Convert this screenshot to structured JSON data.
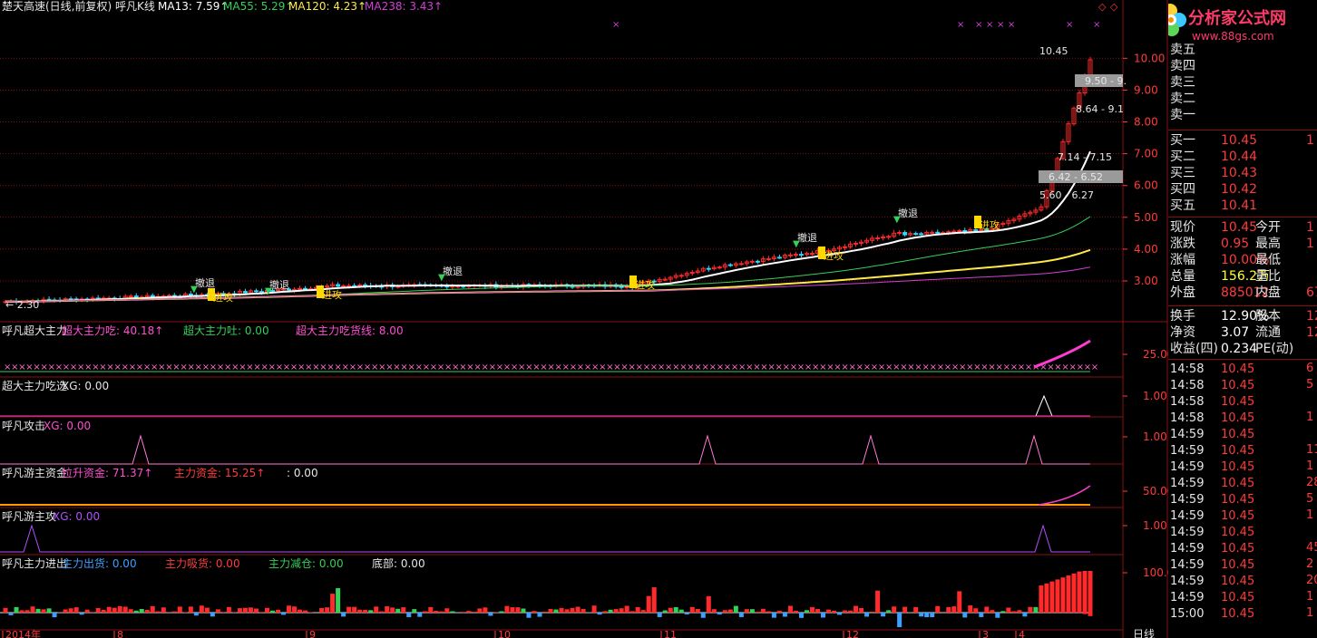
{
  "header": {
    "title": "楚天高速(日线,前复权) 呼凡K线",
    "ma": [
      {
        "label": "MA13: 7.59",
        "color": "#ffffff"
      },
      {
        "label": "MA55: 5.29",
        "color": "#34d058"
      },
      {
        "label": "MA120: 4.23",
        "color": "#ffe94a"
      },
      {
        "label": "MA238: 3.43",
        "color": "#d040d8"
      }
    ]
  },
  "price_axis": {
    "labels": [
      "10.00",
      "9.00",
      "8.00",
      "7.00",
      "6.00",
      "5.00",
      "4.00",
      "3.00"
    ]
  },
  "price_annotations": {
    "high": "10.45",
    "low": "2.30",
    "chips": [
      "9.50 - 9.",
      "8.64 - 9.1",
      "7.14 - 7.15",
      "6.42 - 6.52",
      "5.60 - 6.27"
    ]
  },
  "signals": {
    "retreat": "撤退",
    "attack": "进攻"
  },
  "panels": [
    {
      "name": "super-main",
      "items": [
        {
          "text": "呼凡超大主力",
          "color": "#e6e6e6"
        },
        {
          "text": "超大主力吃: 40.18",
          "color": "#ff4fd0"
        },
        {
          "text": "超大主力吐: 0.00",
          "color": "#34d058"
        },
        {
          "text": "超大主力吃货线: 8.00",
          "color": "#ff4fd0"
        }
      ],
      "axis": "25.00"
    },
    {
      "name": "super-select",
      "items": [
        {
          "text": "超大主力吃选",
          "color": "#e6e6e6"
        },
        {
          "text": "XG: 0.00",
          "color": "#e6e6e6"
        }
      ],
      "axis": "1.00"
    },
    {
      "name": "attack",
      "items": [
        {
          "text": "呼凡攻击",
          "color": "#e6e6e6"
        },
        {
          "text": "XG: 0.00",
          "color": "#ff4fd0"
        }
      ],
      "axis": "1.00"
    },
    {
      "name": "roaming-fund",
      "items": [
        {
          "text": "呼凡游主资金",
          "color": "#e6e6e6"
        },
        {
          "text": "拉升资金: 71.37",
          "color": "#ff4fd0"
        },
        {
          "text": "主力资金: 15.25",
          "color": "#ff3b3b"
        },
        {
          "text": ": 0.00",
          "color": "#e6e6e6"
        }
      ],
      "axis": "50.00"
    },
    {
      "name": "roaming-attack",
      "items": [
        {
          "text": "呼凡游主攻",
          "color": "#e6e6e6"
        },
        {
          "text": "XG: 0.00",
          "color": "#b050ff"
        }
      ],
      "axis": "1.00"
    },
    {
      "name": "main-flow",
      "items": [
        {
          "text": "呼凡主力进出",
          "color": "#e6e6e6"
        },
        {
          "text": "主力出货: 0.00",
          "color": "#3da0ff"
        },
        {
          "text": "主力吸货: 0.00",
          "color": "#ff3b3b"
        },
        {
          "text": "主力减仓: 0.00",
          "color": "#34d058"
        },
        {
          "text": "底部: 0.00",
          "color": "#e6e6e6"
        }
      ],
      "axis": "100.0"
    }
  ],
  "dates": [
    "2014年",
    "8",
    "9",
    "10",
    "11",
    "12",
    "3",
    "4"
  ],
  "period_label": "日线",
  "side": {
    "logo_text": "分析家公式网",
    "logo_url": "www.88gs.com",
    "sell": [
      {
        "label": "卖五"
      },
      {
        "label": "卖四"
      },
      {
        "label": "卖三"
      },
      {
        "label": "卖二"
      },
      {
        "label": "卖一"
      }
    ],
    "buy": [
      {
        "label": "买一",
        "price": "10.45",
        "vol": "1"
      },
      {
        "label": "买二",
        "price": "10.44"
      },
      {
        "label": "买三",
        "price": "10.43"
      },
      {
        "label": "买四",
        "price": "10.42"
      },
      {
        "label": "买五",
        "price": "10.41"
      }
    ],
    "quote": [
      {
        "l1": "现价",
        "v1": "10.45",
        "l2": "今开",
        "v2": "1"
      },
      {
        "l1": "涨跌",
        "v1": "0.95",
        "l2": "最高",
        "v2": "1"
      },
      {
        "l1": "涨幅",
        "v1": "10.00%",
        "l2": "最低",
        "v2": ""
      },
      {
        "l1": "总量",
        "v1": "156.2万",
        "l2": "量比",
        "v2": ""
      },
      {
        "l1": "外盘",
        "v1": "885012",
        "l2": "内盘",
        "v2": "67"
      }
    ],
    "fund": [
      {
        "l1": "换手",
        "v1": "12.90%",
        "l2": "股本",
        "v2": "12"
      },
      {
        "l1": "净资",
        "v1": "3.07",
        "l2": "流通",
        "v2": "12"
      },
      {
        "l1": "收益(四)",
        "v1": "0.234",
        "l2": "PE(动)",
        "v2": ""
      }
    ],
    "ticks": [
      {
        "t": "14:58",
        "p": "10.45",
        "v": "6"
      },
      {
        "t": "14:58",
        "p": "10.45",
        "v": "5"
      },
      {
        "t": "14:58",
        "p": "10.45",
        "v": ""
      },
      {
        "t": "14:58",
        "p": "10.45",
        "v": "1"
      },
      {
        "t": "14:59",
        "p": "10.45",
        "v": ""
      },
      {
        "t": "14:59",
        "p": "10.45",
        "v": "11"
      },
      {
        "t": "14:59",
        "p": "10.45",
        "v": "1"
      },
      {
        "t": "14:59",
        "p": "10.45",
        "v": "28"
      },
      {
        "t": "14:59",
        "p": "10.45",
        "v": "5"
      },
      {
        "t": "14:59",
        "p": "10.45",
        "v": "1"
      },
      {
        "t": "14:59",
        "p": "10.45",
        "v": ""
      },
      {
        "t": "14:59",
        "p": "10.45",
        "v": "45"
      },
      {
        "t": "14:59",
        "p": "10.45",
        "v": "2"
      },
      {
        "t": "14:59",
        "p": "10.45",
        "v": "20"
      },
      {
        "t": "14:59",
        "p": "10.45",
        "v": "1"
      },
      {
        "t": "15:00",
        "p": "10.45",
        "v": "1"
      }
    ]
  },
  "colors": {
    "up": "#ff2a2a",
    "down": "#35d3ff",
    "grid": "#8a1010",
    "bg": "#000000"
  }
}
